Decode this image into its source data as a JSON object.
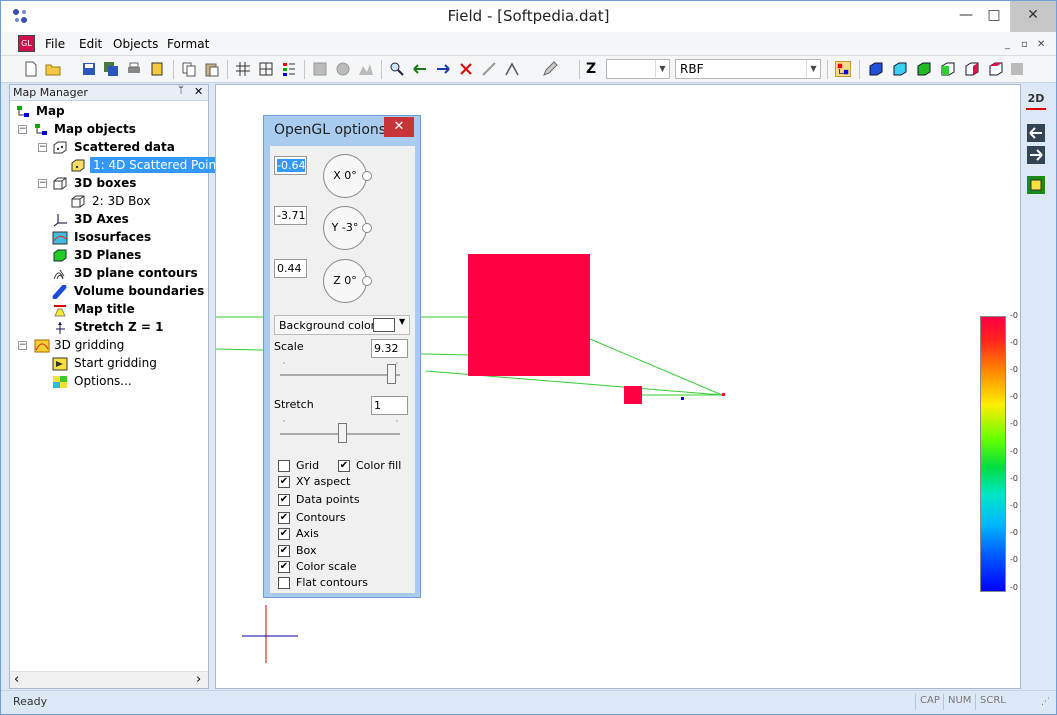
{
  "window": {
    "title": "Field - [Softpedia.dat]",
    "minimize_glyph": "—",
    "maximize_glyph": "□",
    "close_glyph": "✕"
  },
  "menubar": {
    "logo": "GL",
    "items": [
      "File",
      "Edit",
      "Objects",
      "Format"
    ],
    "mdi_glyphs": [
      "_",
      "▫",
      "✕"
    ]
  },
  "toolbar": {
    "z_label": "Z",
    "z_combo_value": "",
    "method_combo_value": "RBF"
  },
  "map_manager": {
    "title": "Map Manager",
    "pin_glyph": "ᛘ",
    "close_glyph": "✕",
    "tree": [
      {
        "label": "Map",
        "bold": true
      },
      {
        "label": "Map objects",
        "bold": true
      },
      {
        "label": "Scattered data",
        "bold": true
      },
      {
        "label": "1: 4D Scattered Points",
        "bold": false,
        "selected": true
      },
      {
        "label": "3D boxes",
        "bold": true
      },
      {
        "label": "2: 3D Box",
        "bold": false
      },
      {
        "label": "3D Axes",
        "bold": true
      },
      {
        "label": "Isosurfaces",
        "bold": true
      },
      {
        "label": "3D Planes",
        "bold": true
      },
      {
        "label": "3D plane contours",
        "bold": true
      },
      {
        "label": "Volume boundaries",
        "bold": true
      },
      {
        "label": "Map title",
        "bold": true
      },
      {
        "label": "Stretch Z = 1",
        "bold": true
      },
      {
        "label": "3D gridding",
        "bold": false
      },
      {
        "label": "Start gridding",
        "bold": false
      },
      {
        "label": "Options...",
        "bold": false
      }
    ],
    "scroll_left": "‹",
    "scroll_right": "›"
  },
  "opengl_dialog": {
    "title": "OpenGL options",
    "close_glyph": "✕",
    "rotation": [
      {
        "value": "-0.64",
        "knob_label": "X 0°"
      },
      {
        "value": "-3.71",
        "knob_label": "Y -3°"
      },
      {
        "value": "0.44",
        "knob_label": "Z 0°"
      }
    ],
    "background_color_label": "Background color",
    "scale_label": "Scale",
    "scale_value": "9.32",
    "scale_level": 0.93,
    "stretch_label": "Stretch",
    "stretch_value": "1",
    "stretch_level": 0.5,
    "checkboxes": [
      {
        "label": "Grid",
        "checked": false
      },
      {
        "label": "Color fill",
        "checked": true
      },
      {
        "label": "XY aspect",
        "checked": true
      },
      {
        "label": "Data points",
        "checked": true
      },
      {
        "label": "Contours",
        "checked": true
      },
      {
        "label": "Axis",
        "checked": true
      },
      {
        "label": "Box",
        "checked": true
      },
      {
        "label": "Color scale",
        "checked": true
      },
      {
        "label": "Flat contours",
        "checked": false
      }
    ],
    "check_glyph": "✔"
  },
  "right_toolbar": {
    "view_2d_label": "2D"
  },
  "color_scale": {
    "tick_labels": [
      "-0",
      "-0",
      "-0",
      "-0",
      "-0",
      "-0",
      "-0",
      "-0",
      "-0",
      "-0",
      "-0"
    ],
    "colors": [
      "#ff0044",
      "#ff8a00",
      "#ffee00",
      "#60ff00",
      "#00dd44",
      "#00e6c8",
      "#00b6ff",
      "#0000ff"
    ]
  },
  "statusbar": {
    "status": "Ready",
    "indicators": [
      "CAP",
      "NUM",
      "SCRL"
    ]
  }
}
